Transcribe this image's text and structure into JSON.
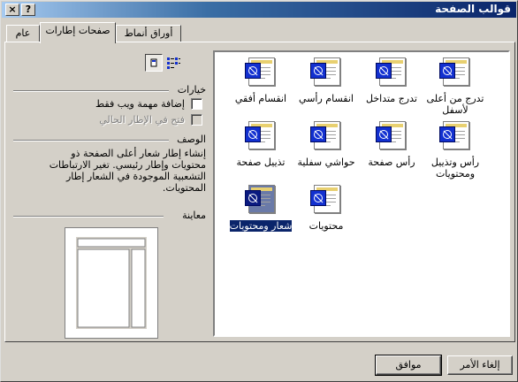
{
  "window": {
    "title": "قوالب الصفحة"
  },
  "title_buttons": {
    "help": "?",
    "close": "×"
  },
  "tabs": [
    {
      "label": "عام",
      "active": false
    },
    {
      "label": "صفحات إطارات",
      "active": true
    },
    {
      "label": "أوراق أنماط",
      "active": false
    }
  ],
  "templates": [
    {
      "label": "تدرج من أعلى لأسفل",
      "selected": false
    },
    {
      "label": "تدرج متداخل",
      "selected": false
    },
    {
      "label": "انقسام رأسي",
      "selected": false
    },
    {
      "label": "انقسام أفقي",
      "selected": false
    },
    {
      "label": "رأس وتذييل ومحتويات",
      "selected": false
    },
    {
      "label": "رأس صفحة",
      "selected": false
    },
    {
      "label": "حواشي سفلية",
      "selected": false
    },
    {
      "label": "تذييل صفحة",
      "selected": false
    },
    {
      "label": "محتويات",
      "selected": false
    },
    {
      "label": "شعار ومحتويات",
      "selected": true
    }
  ],
  "view_buttons": {
    "large_icons": "large-icons-view",
    "list": "list-view"
  },
  "options": {
    "heading": "خيارات",
    "add_web_task": "إضافة مهمة ويب فقط",
    "open_current_frame": "فتح في الإطار الحالي"
  },
  "description": {
    "heading": "الوصف",
    "text": "إنشاء إطار شعار أعلى الصفحة ذو محتويات وإطار رئيسي. تغير الارتباطات التشعبية الموجودة في الشعار إطار المحتويات."
  },
  "preview": {
    "heading": "معاينة"
  },
  "buttons": {
    "ok": "موافق",
    "cancel": "إلغاء الأمر"
  }
}
